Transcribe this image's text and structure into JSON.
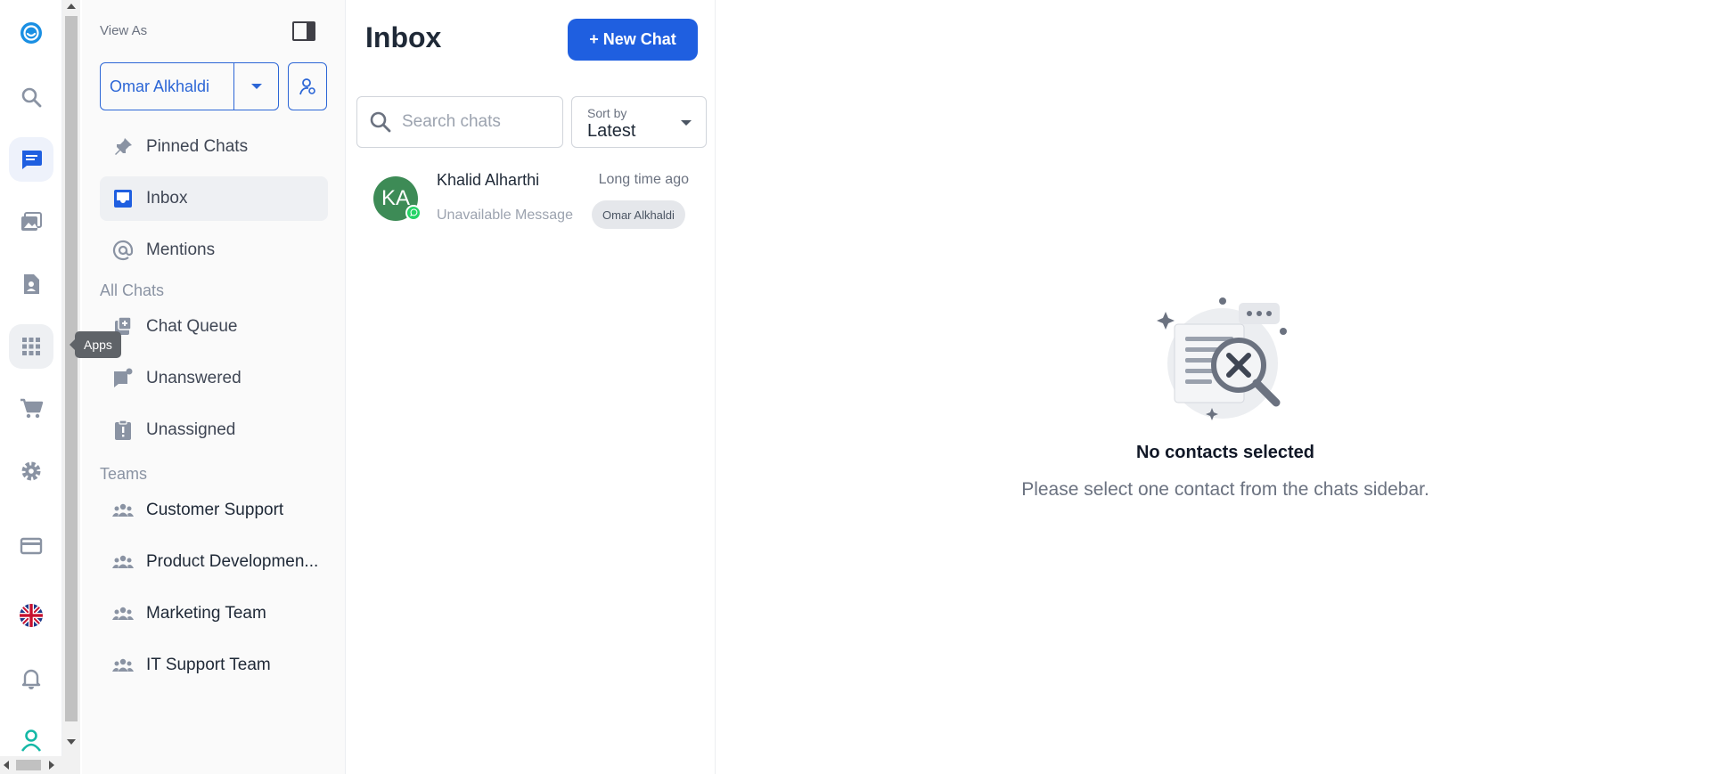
{
  "rail": {
    "items": [
      "brand-logo",
      "search",
      "chats",
      "media",
      "contacts-doc",
      "apps",
      "cart",
      "settings",
      "billing",
      "language-uk",
      "notifications",
      "profile"
    ],
    "active": "chats",
    "tooltip": "Apps"
  },
  "nav": {
    "view_as_label": "View As",
    "agent_name": "Omar Alkhaldi",
    "items": [
      {
        "label": "Pinned Chats"
      },
      {
        "label": "Inbox"
      },
      {
        "label": "Mentions"
      }
    ],
    "all_chats_heading": "All Chats",
    "all_chats": [
      {
        "label": "Chat Queue"
      },
      {
        "label": "Unanswered"
      },
      {
        "label": "Unassigned"
      }
    ],
    "teams_heading": "Teams",
    "teams": [
      {
        "label": "Customer Support"
      },
      {
        "label": "Product Developmen..."
      },
      {
        "label": "Marketing Team"
      },
      {
        "label": "IT Support Team"
      }
    ]
  },
  "inbox": {
    "title": "Inbox",
    "new_chat_label": "+ New Chat",
    "search_placeholder": "Search chats",
    "sort_caption": "Sort by",
    "sort_value": "Latest",
    "chats": [
      {
        "initials": "KA",
        "name": "Khalid Alharthi",
        "time": "Long time ago",
        "preview": "Unavailable Message",
        "assignee": "Omar Alkhaldi",
        "channel": "whatsapp"
      }
    ]
  },
  "empty_state": {
    "title": "No contacts selected",
    "subtitle": "Please select one contact from the chats sidebar."
  },
  "colors": {
    "accent": "#1f5fe0",
    "avatar": "#3d8b56",
    "whatsapp": "#25d366"
  }
}
